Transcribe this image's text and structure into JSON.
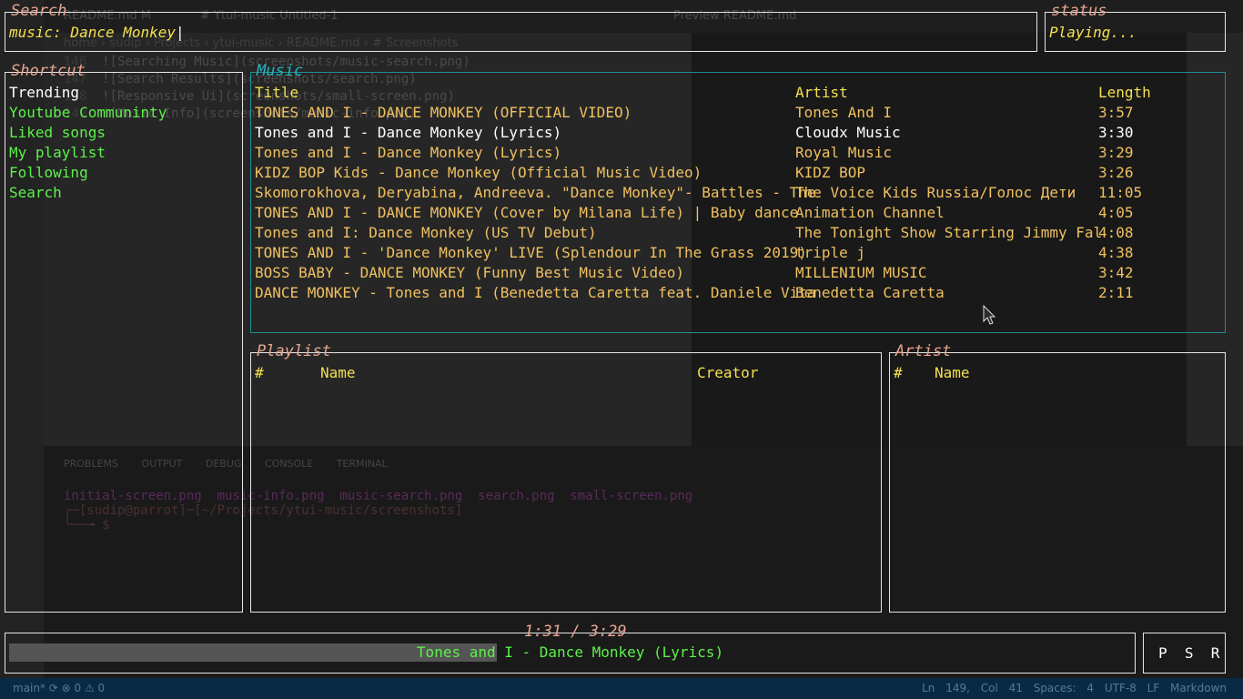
{
  "background": {
    "tabs": [
      "README.md M",
      "# Ytui-music  Untitled-1",
      "Preview README.md"
    ],
    "breadcrumb": "home › sudip › Projects › ytui-music › README.md › # Screenshots",
    "code_lines": [
      {
        "num": "146",
        "text": "![Searching Music](screenshots/music-search.png)"
      },
      {
        "num": "147",
        "text": "![Search Results](screenshots/search.png)"
      },
      {
        "num": "148",
        "text": "![Responsive Ui](screenshots/small-screen.png)"
      },
      {
        "num": "149",
        "text": "![Music Info](screenshots/music-info.png)"
      }
    ],
    "panel_tabs": "PROBLEMS OUTPUT DEBUG CONSOLE TERMINAL",
    "terminal_files": "initial-screen.png  music-info.png  music-search.png  search.png  small-screen.png",
    "terminal_prompt": "┌─[sudip@parrot]─[~/Projects/ytui-music/screenshots]",
    "terminal_prompt2": "└──╼ $",
    "statusbar_left": "main*  ⟳  ⊗ 0 ⚠ 0",
    "statusbar_right": "Ln 149, Col 41  Spaces: 4  UTF-8  LF  Markdown"
  },
  "search": {
    "title": "Search",
    "value": "music: Dance Monkey"
  },
  "status": {
    "title": "status",
    "value": "Playing..."
  },
  "shortcut": {
    "title": "Shortcut",
    "items": [
      "Trending",
      "Youtube Communinty",
      "Liked songs",
      "My playlist",
      "Following",
      "Search"
    ]
  },
  "music": {
    "title": "Music",
    "headers": {
      "title": "Title",
      "artist": "Artist",
      "length": "Length"
    },
    "rows": [
      {
        "title": "TONES AND I - DANCE MONKEY (OFFICIAL VIDEO)",
        "artist": "Tones And I",
        "length": "3:57"
      },
      {
        "title": "Tones and I - Dance Monkey (Lyrics)",
        "artist": "Cloudx Music",
        "length": "3:30"
      },
      {
        "title": "Tones and I - Dance Monkey (Lyrics)",
        "artist": "Royal Music",
        "length": "3:29"
      },
      {
        "title": "KIDZ BOP Kids - Dance Monkey (Official Music Video)",
        "artist": "KIDZ BOP",
        "length": "3:26"
      },
      {
        "title": "Skomorokhova, Deryabina, Andreeva. \"Dance Monkey\"- Battles - The",
        "artist": "The Voice Kids Russia/Голос Дети",
        "length": "11:05"
      },
      {
        "title": "TONES AND I - DANCE MONKEY (Cover by Milana Life) | Baby dance",
        "artist": "Animation Channel",
        "length": "4:05"
      },
      {
        "title": "Tones and I: Dance Monkey (US TV Debut)",
        "artist": "The Tonight Show Starring Jimmy Fal",
        "length": "4:08"
      },
      {
        "title": "TONES AND I - 'Dance Monkey' LIVE (Splendour In The Grass 2019)",
        "artist": "triple j",
        "length": "4:38"
      },
      {
        "title": "BOSS BABY - DANCE MONKEY (Funny Best Music Video)",
        "artist": "MILLENIUM MUSIC",
        "length": "3:42"
      },
      {
        "title": "DANCE MONKEY - Tones and I (Benedetta Caretta feat. Daniele Vita",
        "artist": "Benedetta Caretta",
        "length": "2:11"
      }
    ],
    "selected_index": 1
  },
  "playlist": {
    "title": "Playlist",
    "headers": {
      "num": "#",
      "name": "Name",
      "creator": "Creator"
    }
  },
  "artist": {
    "title": "Artist",
    "headers": {
      "num": "#",
      "name": "Name"
    }
  },
  "player": {
    "time": "1:31 / 3:29",
    "now_playing": "Tones and I - Dance Monkey (Lyrics)",
    "progress_fraction": 0.435
  },
  "controls": {
    "label": "P  S  R"
  },
  "colors": {
    "accent_music_border": "#1f8f96",
    "title_accent": "#e8a590",
    "row_normal": "#f0c060",
    "row_selected": "#ffffff",
    "shortcut_green": "#5cf24a",
    "header_yellow": "#f5e050"
  }
}
